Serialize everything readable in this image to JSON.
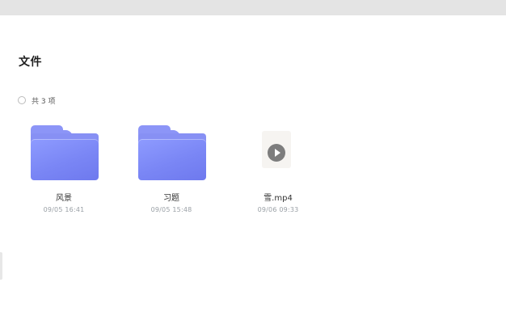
{
  "page": {
    "section_title": "文件",
    "item_count": "共 3 项"
  },
  "files": [
    {
      "name": "风景",
      "date": "09/05 16:41",
      "type": "folder",
      "icon": "folder-icon"
    },
    {
      "name": "习题",
      "date": "09/05 15:48",
      "type": "folder",
      "icon": "folder-icon"
    },
    {
      "name": "雪.mp4",
      "date": "09/06 09:33",
      "type": "video",
      "icon": "play-icon"
    }
  ],
  "colors": {
    "folder": "#8790f4",
    "date_text": "#9aa0a6",
    "top_bar": "#e4e4e4"
  }
}
